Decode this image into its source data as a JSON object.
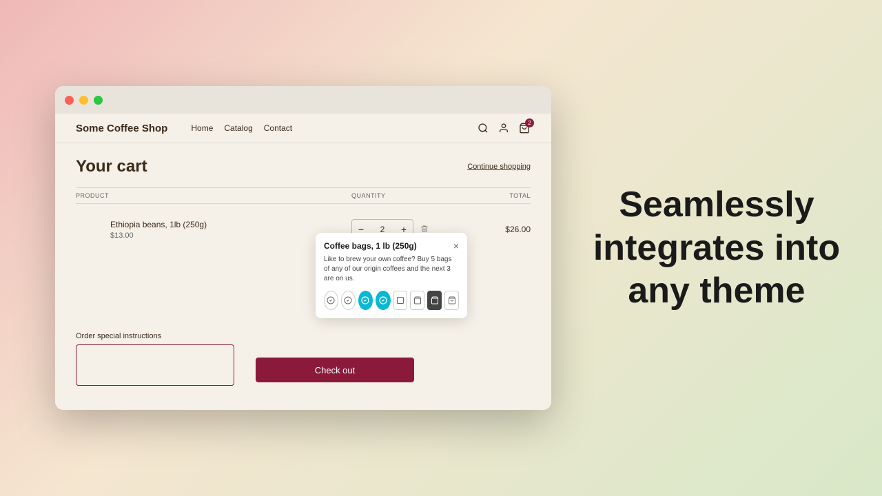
{
  "browser": {
    "traffic_lights": [
      "close",
      "minimize",
      "maximize"
    ]
  },
  "nav": {
    "logo": "Some Coffee Shop",
    "links": [
      "Home",
      "Catalog",
      "Contact"
    ]
  },
  "cart": {
    "title": "Your cart",
    "continue_shopping": "Continue shopping",
    "table_headers": [
      "PRODUCT",
      "QUANTITY",
      "TOTAL"
    ],
    "item": {
      "name": "Ethiopia beans, 1lb (250g)",
      "price": "$13.00",
      "quantity": 2,
      "total": "$26.00"
    },
    "instructions_label": "Order special instructions",
    "checkout_label": "Check out"
  },
  "tooltip": {
    "title": "Coffee bags, 1 lb (250g)",
    "text": "Like to brew your own coffee? Buy 5 bags of any of our origin coffees and the next 3 are on us.",
    "icons": [
      {
        "type": "circle-check",
        "state": "unselected"
      },
      {
        "type": "circle-check",
        "state": "unselected"
      },
      {
        "type": "circle-check",
        "state": "selected"
      },
      {
        "type": "circle-check",
        "state": "selected"
      },
      {
        "type": "square",
        "state": "unselected"
      },
      {
        "type": "bag",
        "state": "unselected"
      },
      {
        "type": "bag-dark",
        "state": "unselected"
      },
      {
        "type": "bag-outline",
        "state": "unselected"
      }
    ],
    "close_label": "×"
  },
  "tagline": {
    "line1": "Seamlessly",
    "line2": "integrates into",
    "line3": "any theme"
  }
}
